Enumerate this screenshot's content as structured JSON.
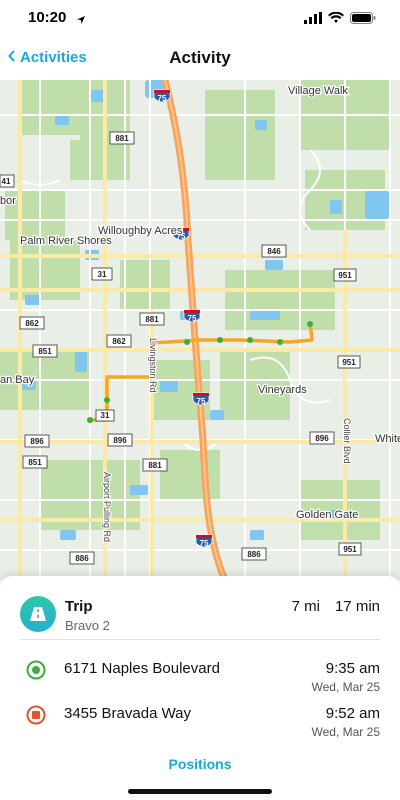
{
  "status": {
    "time": "10:20"
  },
  "nav": {
    "back_label": "Activities",
    "title": "Activity"
  },
  "map": {
    "places": [
      "Village Walk",
      "Palm River Shores",
      "Willoughby Acres",
      "Vineyards",
      "Golden Gate",
      "an Bay",
      "White",
      "bor"
    ],
    "roads": [
      "Airport Pulling Rd",
      "Collier Blvd",
      "Livingston Rd"
    ],
    "shields": [
      "881",
      "41",
      "846",
      "31",
      "951",
      "862",
      "881",
      "862",
      "851",
      "951",
      "896",
      "896",
      "851",
      "881",
      "896",
      "886",
      "886",
      "951",
      "31"
    ],
    "interstate_shields": [
      "75",
      "75",
      "75",
      "75",
      "75"
    ],
    "route_color": "#f5a623",
    "highway_color": "#f7a35c"
  },
  "trip": {
    "title": "Trip",
    "vehicle": "Bravo 2",
    "distance": "7 mi",
    "duration": "17 min"
  },
  "stops": [
    {
      "name": "6171 Naples Boulevard",
      "time": "9:35 am",
      "date": "Wed, Mar 25",
      "type": "start",
      "color": "#3aaf3a"
    },
    {
      "name": "3455 Bravada Way",
      "time": "9:52 am",
      "date": "Wed, Mar 25",
      "type": "end",
      "color": "#e5532d"
    }
  ],
  "actions": {
    "positions_label": "Positions"
  },
  "colors": {
    "accent": "#1aa9d6"
  }
}
